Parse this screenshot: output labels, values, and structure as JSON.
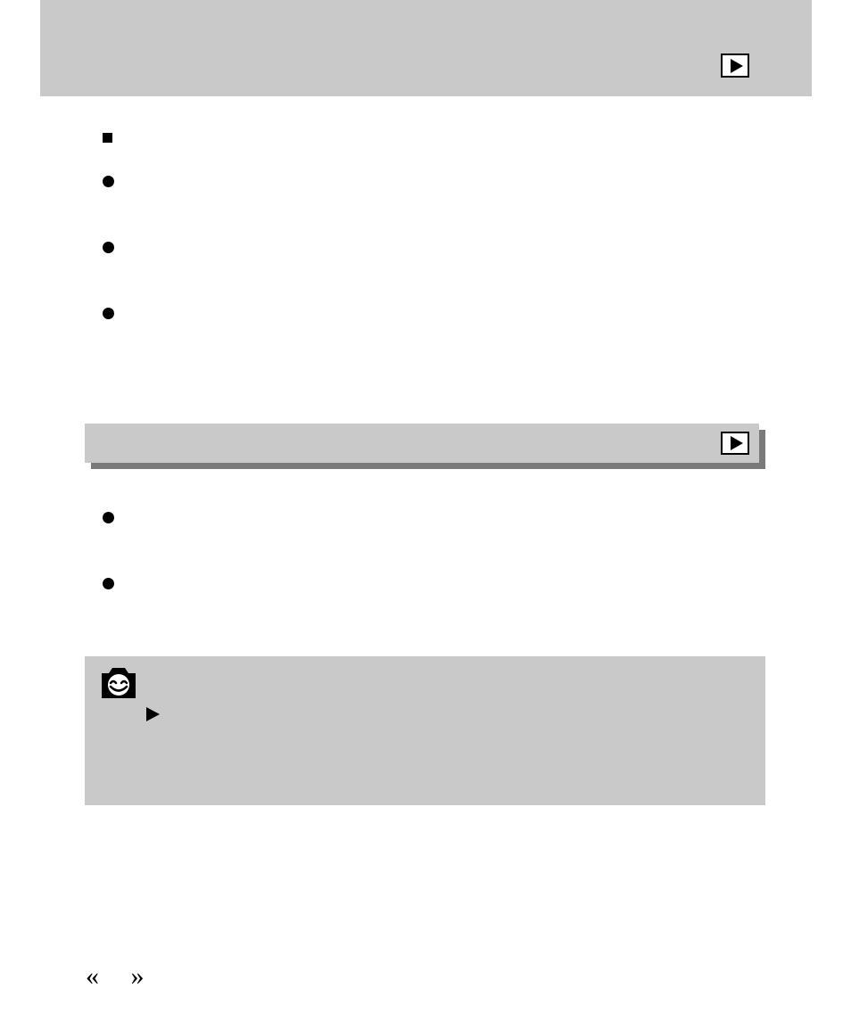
{
  "bottom_text": "«  »"
}
